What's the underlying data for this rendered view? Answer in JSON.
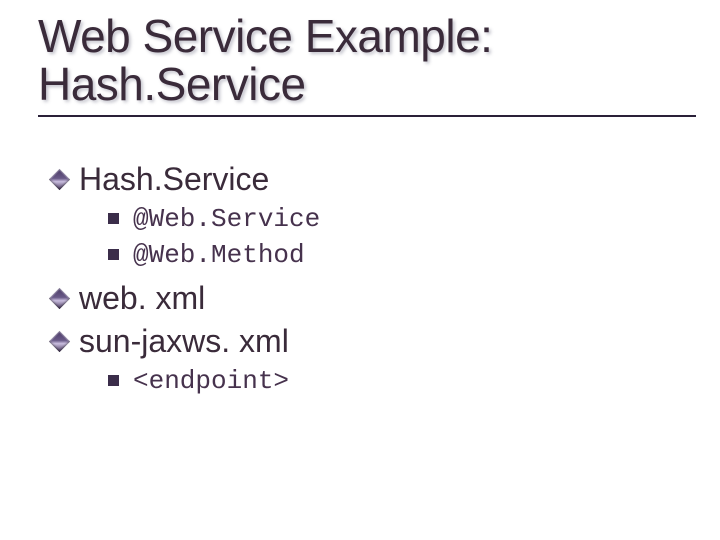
{
  "title": {
    "line1": "Web Service Example:",
    "line2": "Hash.Service"
  },
  "items": {
    "hash_service": "Hash.Service",
    "ann_webservice": "@Web.Service",
    "ann_webmethod": "@Web.Method",
    "web_xml": "web. xml",
    "sun_jaxws": "sun-jaxws. xml",
    "endpoint": "<endpoint>"
  }
}
